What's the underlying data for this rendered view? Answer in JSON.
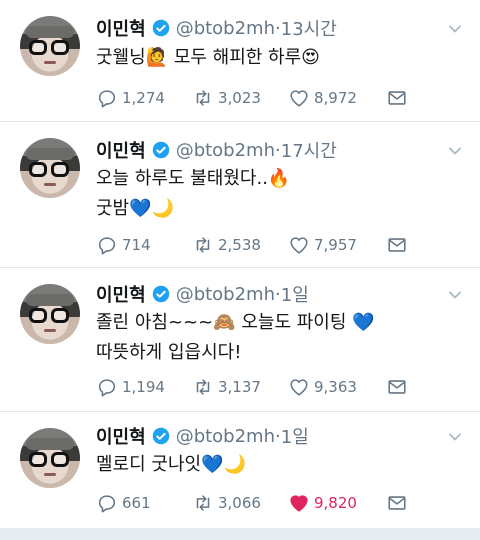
{
  "tweets": [
    {
      "name": "이민혁",
      "handle": "@btob2mh",
      "time": "13시간",
      "lines": [
        "굿웰닝🙋 모두 해피한 하루😍"
      ],
      "replies": "1,274",
      "retweets": "3,023",
      "likes": "8,972",
      "liked": false
    },
    {
      "name": "이민혁",
      "handle": "@btob2mh",
      "time": "17시간",
      "lines": [
        "오늘 하루도 불태웠다..🔥",
        "굿밤💙🌙"
      ],
      "replies": "714",
      "retweets": "2,538",
      "likes": "7,957",
      "liked": false
    },
    {
      "name": "이민혁",
      "handle": "@btob2mh",
      "time": "1일",
      "lines": [
        "졸린 아침~~~🙈 오늘도 파이팅 💙",
        "따뜻하게 입읍시다!"
      ],
      "replies": "1,194",
      "retweets": "3,137",
      "likes": "9,363",
      "liked": false
    },
    {
      "name": "이민혁",
      "handle": "@btob2mh",
      "time": "1일",
      "lines": [
        "멜로디 굿나잇💙🌙"
      ],
      "replies": "661",
      "retweets": "3,066",
      "likes": "9,820",
      "liked": true
    }
  ],
  "separator": "·",
  "icons": {
    "reply": "reply-icon",
    "retweet": "retweet-icon",
    "like": "heart-icon",
    "dm": "envelope-icon",
    "verified": "verified-badge-icon",
    "caret": "chevron-down-icon"
  },
  "colors": {
    "verified": "#1da1f2",
    "muted": "#657786",
    "liked": "#e0245e",
    "divider": "#e1e8ed"
  }
}
